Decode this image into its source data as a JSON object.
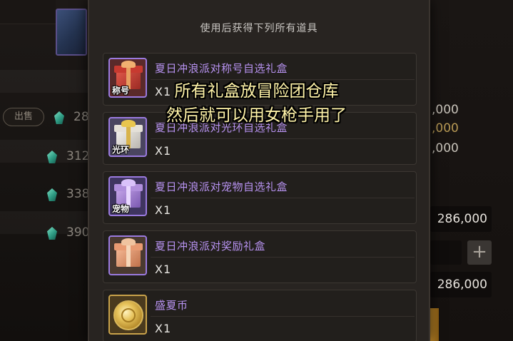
{
  "popup": {
    "title": "使用后获得下列所有道具",
    "items": [
      {
        "name": "夏日冲浪派对称号自选礼盒",
        "qty": "X1",
        "tag": "称号",
        "icon": "red-gift-box-icon"
      },
      {
        "name": "夏日冲浪派对光环自选礼盒",
        "qty": "X1",
        "tag": "光环",
        "icon": "white-gift-box-icon"
      },
      {
        "name": "夏日冲浪派对宠物自选礼盒",
        "qty": "X1",
        "tag": "宠物",
        "icon": "purple-gift-box-icon"
      },
      {
        "name": "夏日冲浪派对奖励礼盒",
        "qty": "X1",
        "tag": "",
        "icon": "orange-gift-box-icon"
      },
      {
        "name": "盛夏币",
        "qty": "X1",
        "tag": "",
        "icon": "gold-coin-icon"
      }
    ]
  },
  "caption": {
    "line1": "所有礼盒放冒险团仓库",
    "line2": "然后就可以用女枪手用了"
  },
  "background": {
    "sell_button": "出售",
    "left_values": [
      "28",
      "312",
      "338",
      "390"
    ],
    "right_values": [
      ",000",
      ",000",
      ",000"
    ],
    "price_top": "286,000",
    "price_bottom": "286,000",
    "plus_label": "+"
  },
  "colors": {
    "item_name": "#b792f0",
    "caption": "#fff3a8",
    "popup_bg": "#282421"
  }
}
